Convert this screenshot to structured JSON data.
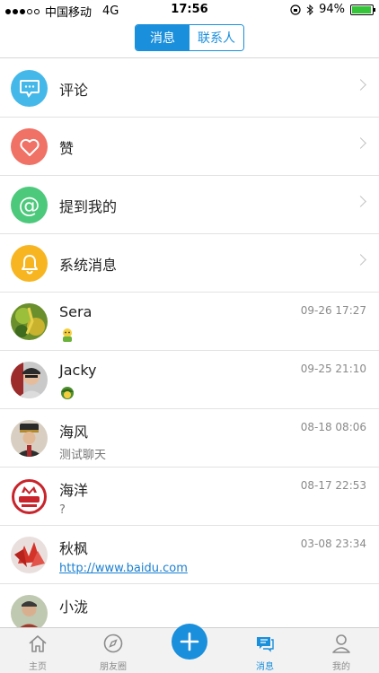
{
  "status_bar": {
    "carrier": "中国移动",
    "network": "4G",
    "time": "17:56",
    "battery": "94%",
    "battery_level": 0.94
  },
  "segmented": {
    "tabs": [
      {
        "label": "消息",
        "active": true
      },
      {
        "label": "联系人",
        "active": false
      }
    ]
  },
  "categories": [
    {
      "label": "评论",
      "icon": "comment-icon",
      "color": "#45b8ea"
    },
    {
      "label": "赞",
      "icon": "heart-icon",
      "color": "#f07165"
    },
    {
      "label": "提到我的",
      "icon": "at-icon",
      "color": "#4cc97b"
    },
    {
      "label": "系统消息",
      "icon": "bell-icon",
      "color": "#f7b621"
    }
  ],
  "messages": [
    {
      "name": "Sera",
      "time": "09-26 17:27",
      "preview": ""
    },
    {
      "name": "Jacky",
      "time": "09-25 21:10",
      "preview": ""
    },
    {
      "name": "海风",
      "time": "08-18 08:06",
      "preview": "测试聊天"
    },
    {
      "name": "海洋",
      "time": "08-17 22:53",
      "preview": "?"
    },
    {
      "name": "秋枫",
      "time": "03-08 23:34",
      "preview": "http://www.baidu.com"
    },
    {
      "name": "小泷",
      "time": "",
      "preview": ""
    }
  ],
  "tabbar": {
    "items": [
      {
        "label": "主页",
        "icon": "home-icon"
      },
      {
        "label": "朋友圈",
        "icon": "compass-icon"
      },
      {
        "label": "",
        "icon": "plus-icon"
      },
      {
        "label": "消息",
        "icon": "message-icon",
        "active": true
      },
      {
        "label": "我的",
        "icon": "person-icon"
      }
    ]
  }
}
